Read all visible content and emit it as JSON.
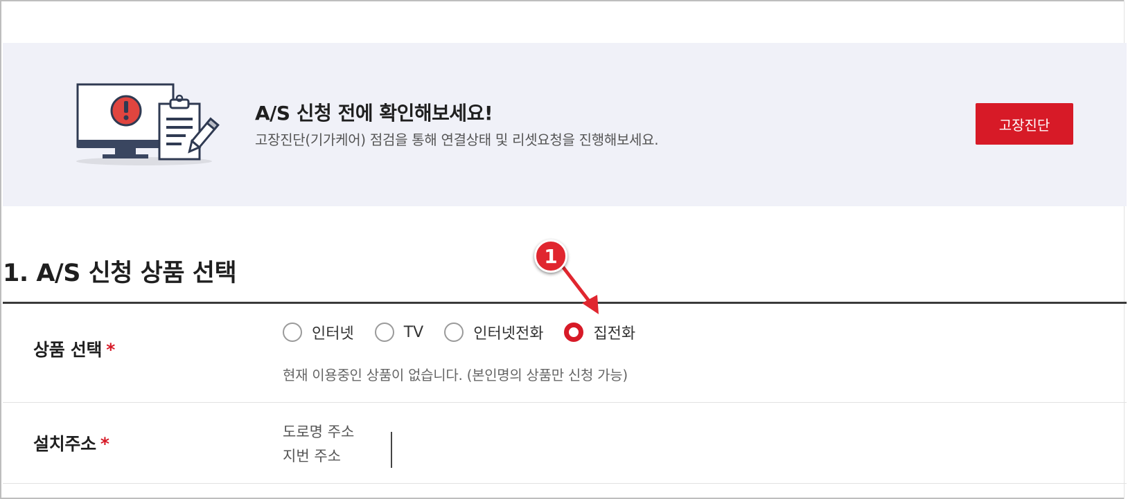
{
  "banner": {
    "title": "A/S 신청 전에 확인해보세요!",
    "description": "고장진단(기가케어) 점검을 통해 연결상태 및 리셋요청을 진행해보세요.",
    "button_label": "고장진단",
    "illustration": "monitor-alert-clipboard-icon"
  },
  "section": {
    "title": "1. A/S 신청 상품 선택"
  },
  "product_field": {
    "label": "상품 선택",
    "required_mark": "*",
    "options": [
      {
        "label": "인터넷",
        "checked": false
      },
      {
        "label": "TV",
        "checked": false
      },
      {
        "label": "인터넷전화",
        "checked": false
      },
      {
        "label": "집전화",
        "checked": true
      }
    ],
    "note": "현재 이용중인 상품이 없습니다. (본인명의 상품만 신청 가능)"
  },
  "address_field": {
    "label": "설치주소",
    "required_mark": "*",
    "road_label": "도로명 주소",
    "lot_label": "지번 주소"
  },
  "annotation": {
    "badge": "1"
  },
  "colors": {
    "accent": "#d71a27",
    "banner_bg": "#f0f1f8"
  }
}
